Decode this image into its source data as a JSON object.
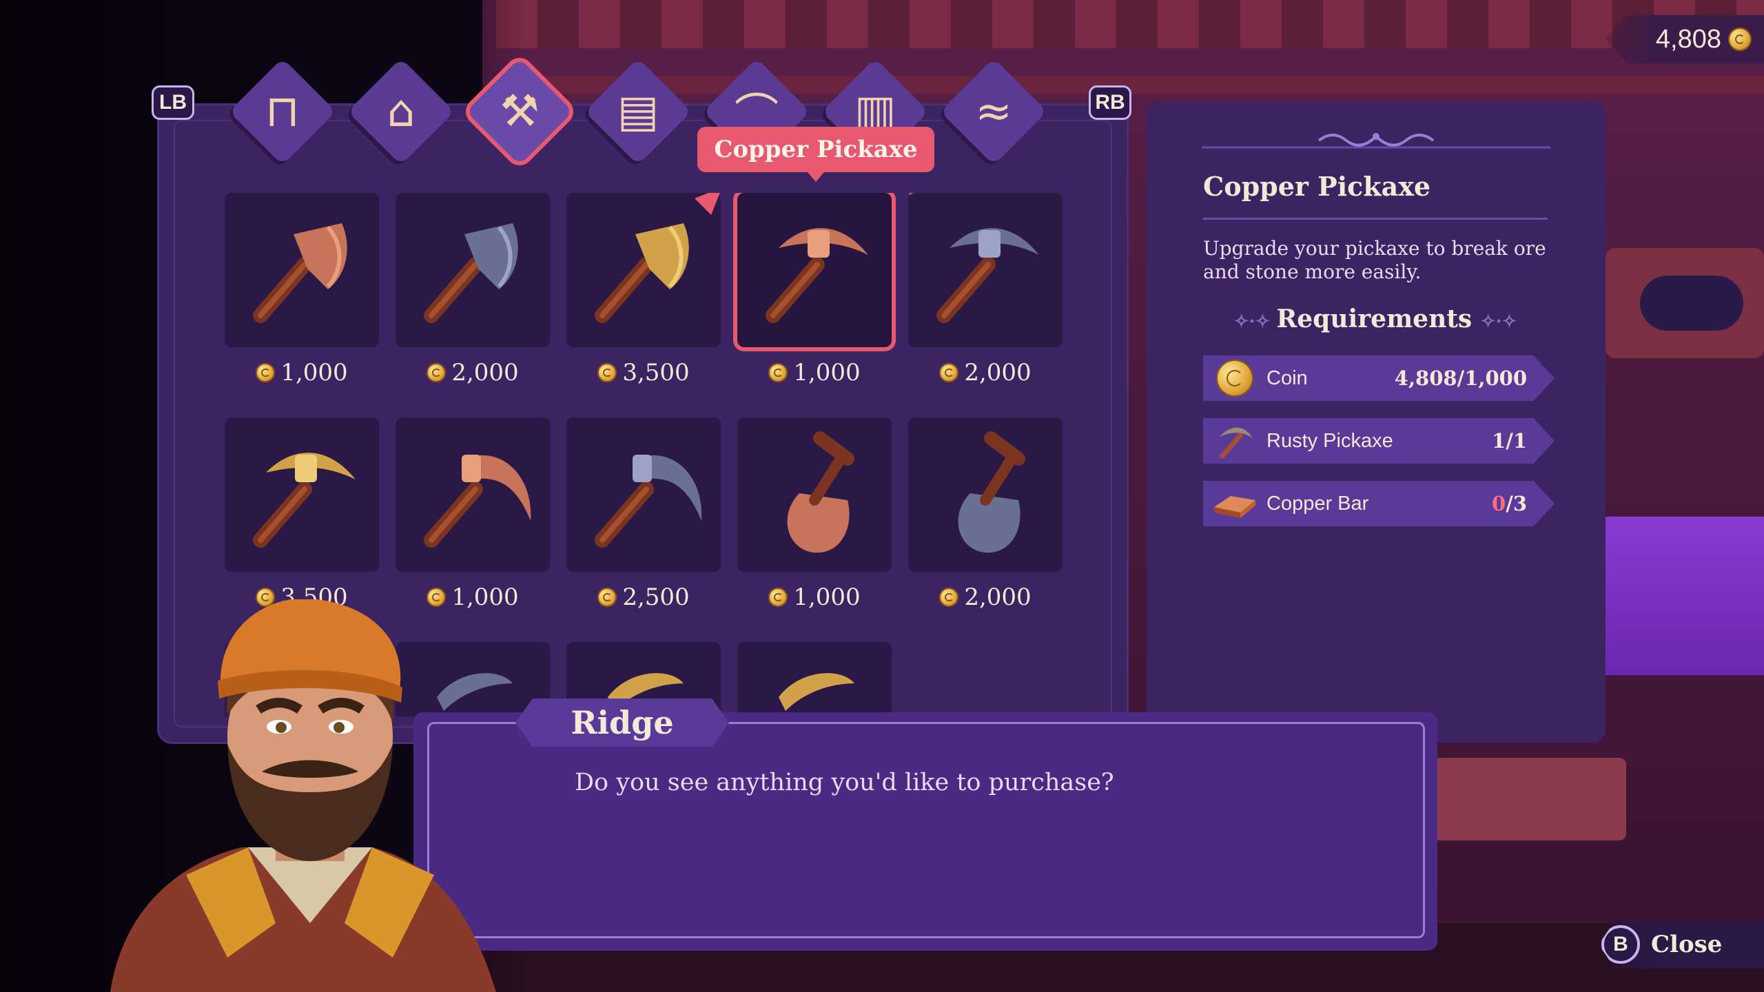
{
  "currency": {
    "amount": "4,808",
    "icon": "coin-icon"
  },
  "shoulder_buttons": {
    "left": "LB",
    "right": "RB"
  },
  "tabs": [
    {
      "name": "furniture-tab",
      "icon": "table-icon",
      "glyph": "⊓"
    },
    {
      "name": "buildings-tab",
      "icon": "house-icon",
      "glyph": "⌂"
    },
    {
      "name": "tools-tab",
      "icon": "hammer-pickaxe-icon",
      "glyph": "⚒",
      "active": true
    },
    {
      "name": "blueprints-tab",
      "icon": "scroll-icon",
      "glyph": "▤"
    },
    {
      "name": "windows-tab",
      "icon": "arch-window-icon",
      "glyph": "⌒"
    },
    {
      "name": "books-tab",
      "icon": "book-icon",
      "glyph": "▥"
    },
    {
      "name": "maps-tab",
      "icon": "map-icon",
      "glyph": "≈"
    }
  ],
  "tooltip": "Copper Pickaxe",
  "items": [
    {
      "kind": "axe",
      "metal": "copper",
      "price": "1,000"
    },
    {
      "kind": "axe",
      "metal": "iron",
      "price": "2,000"
    },
    {
      "kind": "axe",
      "metal": "gold",
      "price": "3,500"
    },
    {
      "kind": "pickaxe",
      "metal": "copper",
      "price": "1,000",
      "selected": true
    },
    {
      "kind": "pickaxe",
      "metal": "iron",
      "price": "2,000"
    },
    {
      "kind": "pickaxe",
      "metal": "gold",
      "price": "3,500"
    },
    {
      "kind": "scythe",
      "metal": "copper",
      "price": "1,000"
    },
    {
      "kind": "scythe",
      "metal": "iron",
      "price": "2,500"
    },
    {
      "kind": "shovel",
      "metal": "copper",
      "price": "1,000"
    },
    {
      "kind": "shovel",
      "metal": "iron",
      "price": "2,000"
    },
    {
      "kind": "partial",
      "metal": "copper",
      "price": ""
    },
    {
      "kind": "partial",
      "metal": "iron",
      "price": ""
    },
    {
      "kind": "partial",
      "metal": "gold",
      "price": ""
    },
    {
      "kind": "partial",
      "metal": "gold",
      "price": ""
    }
  ],
  "metals": {
    "copper": {
      "head": "#c8745a",
      "light": "#e8a07c"
    },
    "iron": {
      "head": "#6a6f94",
      "light": "#9ca2c8"
    },
    "gold": {
      "head": "#d2a24a",
      "light": "#f0cc78"
    }
  },
  "details": {
    "title": "Copper Pickaxe",
    "description": "Upgrade your pickaxe to break ore and stone more easily.",
    "requirements_heading": "Requirements",
    "requirements": [
      {
        "icon": "coin-icon",
        "label": "Coin",
        "have": "4,808",
        "need": "1,000",
        "met": true
      },
      {
        "icon": "rusty-pickaxe-icon",
        "label": "Rusty Pickaxe",
        "have": "1",
        "need": "1",
        "met": true
      },
      {
        "icon": "copper-bar-icon",
        "label": "Copper Bar",
        "have": "0",
        "need": "3",
        "met": false
      }
    ]
  },
  "dialog": {
    "speaker": "Ridge",
    "text": "Do you see anything you'd like to purchase?"
  },
  "close": {
    "button": "B",
    "label": "Close"
  },
  "colors": {
    "accent": "#e8586e",
    "panel": "#3c2463",
    "tile": "#2a1846"
  }
}
